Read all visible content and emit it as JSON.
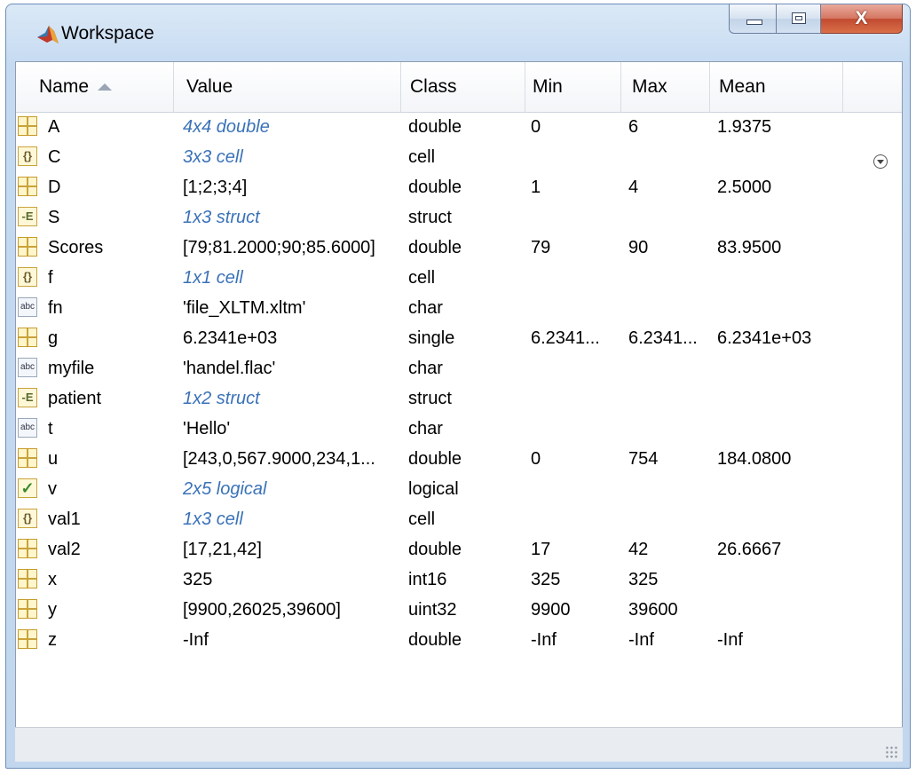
{
  "window": {
    "title": "Workspace",
    "controls": {
      "minimize": "minimize",
      "maximize": "maximize",
      "close": "X"
    }
  },
  "columns": [
    "Name",
    "Value",
    "Class",
    "Min",
    "Max",
    "Mean"
  ],
  "sort": {
    "column": "Name",
    "direction": "ascending"
  },
  "variables": [
    {
      "name": "A",
      "value": "4x4 double",
      "class": "double",
      "min": "0",
      "max": "6",
      "mean": "1.9375",
      "icon": "matrix-icon",
      "link": true
    },
    {
      "name": "C",
      "value": "3x3 cell",
      "class": "cell",
      "min": "",
      "max": "",
      "mean": "",
      "icon": "cell-array-icon",
      "link": true
    },
    {
      "name": "D",
      "value": "[1;2;3;4]",
      "class": "double",
      "min": "1",
      "max": "4",
      "mean": "2.5000",
      "icon": "matrix-icon",
      "link": false
    },
    {
      "name": "S",
      "value": "1x3 struct",
      "class": "struct",
      "min": "",
      "max": "",
      "mean": "",
      "icon": "struct-icon",
      "link": true
    },
    {
      "name": "Scores",
      "value": "[79;81.2000;90;85.6000]",
      "class": "double",
      "min": "79",
      "max": "90",
      "mean": "83.9500",
      "icon": "matrix-icon",
      "link": false
    },
    {
      "name": "f",
      "value": "1x1 cell",
      "class": "cell",
      "min": "",
      "max": "",
      "mean": "",
      "icon": "cell-array-icon",
      "link": true
    },
    {
      "name": "fn",
      "value": "'file_XLTM.xltm'",
      "class": "char",
      "min": "",
      "max": "",
      "mean": "",
      "icon": "char-icon",
      "link": false
    },
    {
      "name": "g",
      "value": "6.2341e+03",
      "class": "single",
      "min": "6.2341...",
      "max": "6.2341...",
      "mean": "6.2341e+03",
      "icon": "matrix-icon",
      "link": false
    },
    {
      "name": "myfile",
      "value": "'handel.flac'",
      "class": "char",
      "min": "",
      "max": "",
      "mean": "",
      "icon": "char-icon",
      "link": false
    },
    {
      "name": "patient",
      "value": "1x2 struct",
      "class": "struct",
      "min": "",
      "max": "",
      "mean": "",
      "icon": "struct-icon",
      "link": true
    },
    {
      "name": "t",
      "value": "'Hello'",
      "class": "char",
      "min": "",
      "max": "",
      "mean": "",
      "icon": "char-icon",
      "link": false
    },
    {
      "name": "u",
      "value": "[243,0,567.9000,234,1...",
      "class": "double",
      "min": "0",
      "max": "754",
      "mean": "184.0800",
      "icon": "matrix-icon",
      "link": false
    },
    {
      "name": "v",
      "value": "2x5 logical",
      "class": "logical",
      "min": "",
      "max": "",
      "mean": "",
      "icon": "logical-icon",
      "link": true
    },
    {
      "name": "val1",
      "value": "1x3 cell",
      "class": "cell",
      "min": "",
      "max": "",
      "mean": "",
      "icon": "cell-array-icon",
      "link": true
    },
    {
      "name": "val2",
      "value": "[17,21,42]",
      "class": "double",
      "min": "17",
      "max": "42",
      "mean": "26.6667",
      "icon": "matrix-icon",
      "link": false
    },
    {
      "name": "x",
      "value": "325",
      "class": "int16",
      "min": "325",
      "max": "325",
      "mean": "",
      "icon": "matrix-icon",
      "link": false
    },
    {
      "name": "y",
      "value": "[9900,26025,39600]",
      "class": "uint32",
      "min": "9900",
      "max": "39600",
      "mean": "",
      "icon": "matrix-icon",
      "link": false
    },
    {
      "name": "z",
      "value": "-Inf",
      "class": "double",
      "min": "-Inf",
      "max": "-Inf",
      "mean": "-Inf",
      "icon": "matrix-icon",
      "link": false
    }
  ],
  "status_text": ""
}
